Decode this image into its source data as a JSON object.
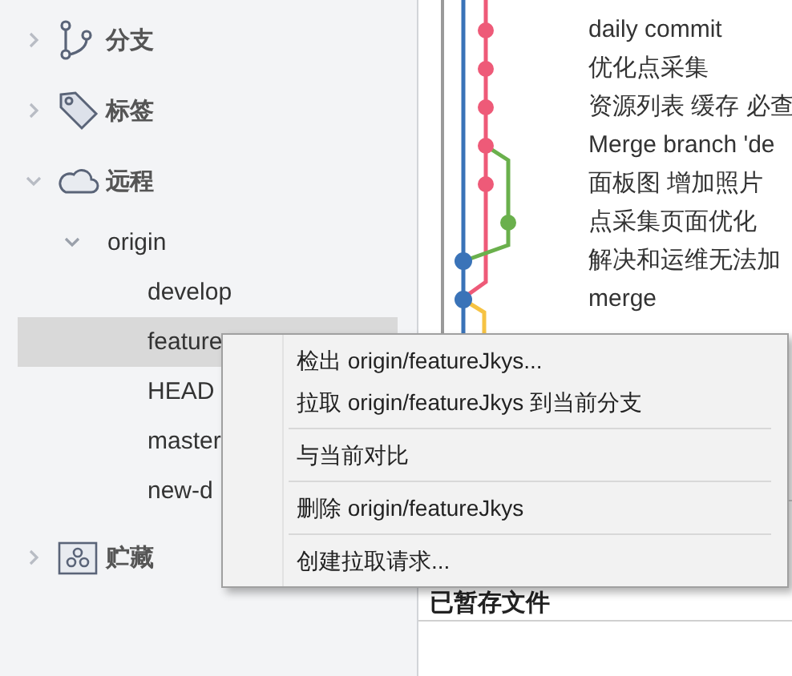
{
  "sidebar": {
    "sections": [
      {
        "kind": "branch",
        "label": "分支",
        "expanded": false
      },
      {
        "kind": "tag",
        "label": "标签",
        "expanded": false
      },
      {
        "kind": "remote",
        "label": "远程",
        "expanded": true,
        "children": [
          {
            "label": "origin",
            "expanded": true,
            "children": [
              {
                "label": "develop",
                "selected": false
              },
              {
                "label": "feature",
                "selected": true
              },
              {
                "label": "HEAD",
                "selected": false
              },
              {
                "label": "master",
                "selected": false
              },
              {
                "label": "new-d",
                "selected": false
              }
            ]
          }
        ]
      },
      {
        "kind": "stash",
        "label": "贮藏",
        "expanded": false
      }
    ]
  },
  "commits": [
    "daily commit",
    "优化点采集",
    "资源列表 缓存 必查",
    "Merge branch 'de",
    "面板图 增加照片",
    "点采集页面优化",
    "解决和运维无法加",
    "merge"
  ],
  "staged_header": "已暂存文件",
  "context_menu": {
    "groups": [
      {
        "items": [
          "检出 origin/featureJkys...",
          "拉取 origin/featureJkys 到当前分支"
        ]
      },
      {
        "items": [
          "与当前对比"
        ]
      },
      {
        "items": [
          "删除 origin/featureJkys"
        ]
      },
      {
        "items": [
          "创建拉取请求..."
        ]
      }
    ]
  }
}
